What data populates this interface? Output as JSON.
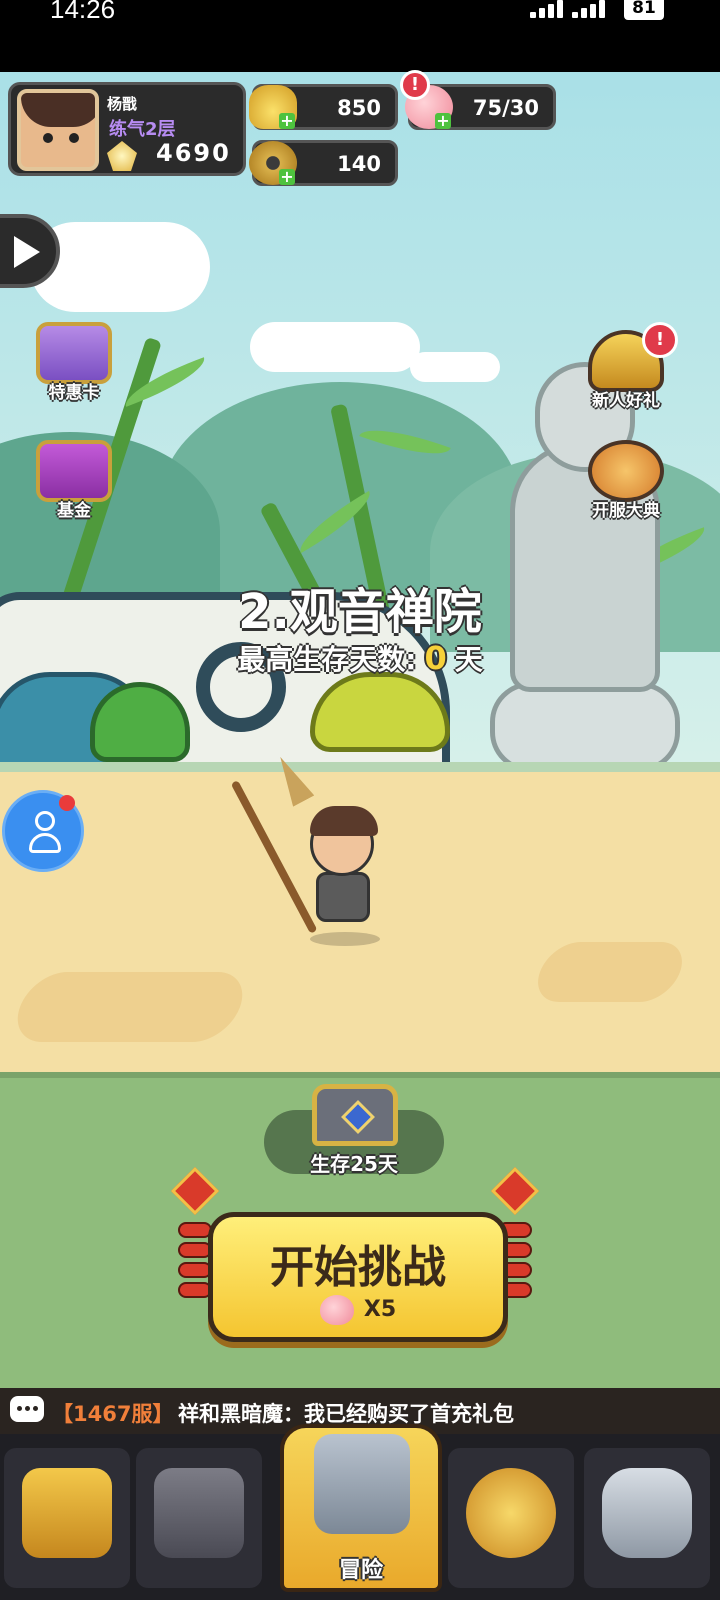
{
  "status_bar": {
    "time": "14:26",
    "battery": "81"
  },
  "player": {
    "name": "杨戬",
    "rank": "练气2层",
    "power": "4690"
  },
  "resources": {
    "gold": "850",
    "stamina": "75/30",
    "coins": "140"
  },
  "side_left": [
    {
      "label": "特惠卡"
    },
    {
      "label": "基金"
    }
  ],
  "side_right": [
    {
      "label": "新人好礼"
    },
    {
      "label": "开服大典"
    }
  ],
  "stage": {
    "title": "2.观音禅院",
    "survival_label": "最高生存天数:",
    "survival_days": "0",
    "survival_unit": "天"
  },
  "chest": {
    "label": "生存25天"
  },
  "start": {
    "label": "开始挑战",
    "cost": "X5"
  },
  "chat": {
    "server": "【1467服】",
    "message": "祥和黑暗魔：我已经购买了首充礼包"
  },
  "nav": [
    {
      "label": ""
    },
    {
      "label": ""
    },
    {
      "label": "冒险"
    },
    {
      "label": ""
    },
    {
      "label": ""
    }
  ],
  "colors": {
    "accent": "#f4c530",
    "alert": "#e03a4a",
    "friend": "#3a8ff0"
  }
}
